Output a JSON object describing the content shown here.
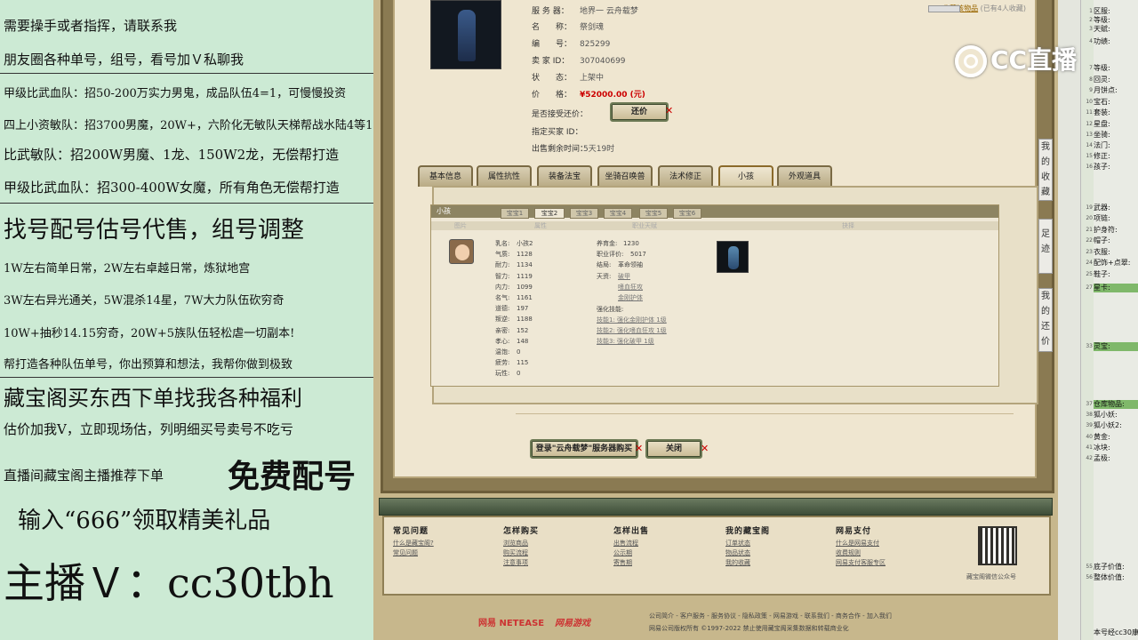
{
  "left_overlay": {
    "lines": [
      "需要操手或者指挥，请联系我",
      "朋友圈各种单号，组号，看号加Ｖ私聊我",
      "甲级比武血队：招50-200万实力男鬼，成品队伍4=1，可慢慢投资",
      "四上小资敏队：招3700男魔，20W+，六阶化无敏队天梯帮战水陆4等1",
      "比武敏队：招200W男魔、1龙、150W2龙，无偿帮打造",
      "甲级比武血队：招300-400W女魔，所有角色无偿帮打造",
      "找号配号估号代售，组号调整",
      "1W左右简单日常，2W左右卓越日常，炼狱地宫",
      "3W左右异光通关，5W混杀14星，7W大力队伍砍穷奇",
      "10W+抽秒14.15穷奇，20W+5族队伍轻松虐一切副本!",
      "帮打造各种队伍单号，你出预算和想法，我帮你做到极致",
      "藏宝阁买东西下单找我各种福利",
      "估价加我V，立即现场估，列明细买号卖号不吃亏",
      "直播间藏宝阁主播推荐下单",
      "免费配号",
      "输入“666”领取精美礼品",
      "主播Ｖ：cc30tbh"
    ]
  },
  "product": {
    "fields": [
      {
        "k": "服 务 器：",
        "v": "地界一 云舟载梦"
      },
      {
        "k": "名　　称：",
        "v": "祭剑魂"
      },
      {
        "k": "编　　号：",
        "v": "825299"
      },
      {
        "k": "卖 家 ID：",
        "v": "307040699"
      },
      {
        "k": "状　　态：",
        "v": "上架中"
      },
      {
        "k": "价　　格：",
        "v": "¥52000.00 (元)"
      },
      {
        "k": "是否接受还价：",
        "v": ""
      },
      {
        "k": "指定买家 ID：",
        "v": ""
      },
      {
        "k": "出售剩余时间：",
        "v": "5天19时"
      }
    ],
    "favorite": "收藏该物品",
    "favorite_count": "(已有4人收藏)",
    "counter_offer_button": "还价"
  },
  "tabs": [
    "基本信息",
    "属性抗性",
    "装备法宝",
    "坐骑召唤兽",
    "法术修正",
    "小孩",
    "外观道具"
  ],
  "active_tab": "小孩",
  "child_panel": {
    "title": "小孩",
    "subtabs": [
      "宝宝1",
      "宝宝2",
      "宝宝3",
      "宝宝4",
      "宝宝5",
      "宝宝6"
    ],
    "columns": [
      "图片",
      "属性",
      "职业天赋",
      "抉择"
    ],
    "stats_left": [
      {
        "k": "乳名:",
        "v": "小孩2"
      },
      {
        "k": "气质:",
        "v": "1128"
      },
      {
        "k": "耐力:",
        "v": "1134"
      },
      {
        "k": "智力:",
        "v": "1119"
      },
      {
        "k": "内力:",
        "v": "1099"
      },
      {
        "k": "名气:",
        "v": "1161"
      },
      {
        "k": "道德:",
        "v": "197"
      },
      {
        "k": "叛逆:",
        "v": "1188"
      },
      {
        "k": "亲密:",
        "v": "152"
      },
      {
        "k": "孝心:",
        "v": "148"
      },
      {
        "k": "温饱:",
        "v": "0"
      },
      {
        "k": "疲劳:",
        "v": "115"
      },
      {
        "k": "玩性:",
        "v": "0"
      }
    ],
    "stats_right": [
      {
        "k": "养育金:",
        "v": "1230"
      },
      {
        "k": "职业评价:",
        "v": "5017"
      },
      {
        "k": "结局:",
        "v": "革命领袖"
      },
      {
        "k": "天资:",
        "v": "破甲"
      }
    ],
    "talents_extra": [
      "嗜血狂攻",
      "金刚护体"
    ],
    "skills_title": "强化技能:",
    "skills": [
      "技能1: 强化金刚护体 1级",
      "技能2: 强化嗜血狂攻 1级",
      "技能3: 强化破甲 1级"
    ]
  },
  "buttons": {
    "login": "登录\"云舟载梦\"服务器购买",
    "close": "关闭"
  },
  "footer": {
    "columns": [
      {
        "title": "常见问题",
        "links": [
          "什么是藏宝阁?",
          "常见问题"
        ]
      },
      {
        "title": "怎样购买",
        "links": [
          "浏览商品",
          "购买流程",
          "注意事项"
        ]
      },
      {
        "title": "怎样出售",
        "links": [
          "出售流程",
          "公示期",
          "寄售期"
        ]
      },
      {
        "title": "我的藏宝阁",
        "links": [
          "订单状态",
          "物品状态",
          "我的收藏"
        ]
      },
      {
        "title": "网易支付",
        "links": [
          "什么是网易支付",
          "收费规则",
          "网易支付客服专区"
        ]
      }
    ],
    "qr_caption": "藏宝阁微信公众号",
    "bottom_links": "公司简介 - 客户服务 - 服务协议 - 隐私政策 - 网易游戏 - 联系我们 - 商务合作 - 加入我们",
    "copyright": "网易公司版权所有 ©1997-2022   禁止使用藏宝阁采集数据和转载商业化",
    "brand1": "网易 NETEASE",
    "brand2": "网易游戏"
  },
  "side_tabs": [
    "我的收藏",
    "足迹",
    "我的还价"
  ],
  "right_panel": {
    "rows": [
      {
        "n": "1",
        "t": "区服:",
        "g": false
      },
      {
        "n": "2",
        "t": "等级:",
        "g": false
      },
      {
        "n": "3",
        "t": "天赋:",
        "g": false
      },
      {
        "n": "4",
        "t": "功绩:",
        "g": false
      },
      {
        "n": "7",
        "t": "等级:",
        "g": false
      },
      {
        "n": "8",
        "t": "回灵:",
        "g": false
      },
      {
        "n": "9",
        "t": "月饼点:",
        "g": false
      },
      {
        "n": "10",
        "t": "宝石:",
        "g": false
      },
      {
        "n": "11",
        "t": "套装:",
        "g": false
      },
      {
        "n": "12",
        "t": "星盘:",
        "g": false
      },
      {
        "n": "13",
        "t": "坐骑:",
        "g": false
      },
      {
        "n": "14",
        "t": "法门:",
        "g": false
      },
      {
        "n": "15",
        "t": "修正:",
        "g": false
      },
      {
        "n": "16",
        "t": "孩子:",
        "g": false
      },
      {
        "n": "19",
        "t": "武器:",
        "g": false
      },
      {
        "n": "20",
        "t": "项链:",
        "g": false
      },
      {
        "n": "21",
        "t": "护身符:",
        "g": false
      },
      {
        "n": "22",
        "t": "帽子:",
        "g": false
      },
      {
        "n": "23",
        "t": "衣服:",
        "g": false
      },
      {
        "n": "24",
        "t": "配饰+点翠:",
        "g": false
      },
      {
        "n": "25",
        "t": "鞋子:",
        "g": false
      },
      {
        "n": "27",
        "t": "星卡:",
        "g": true
      },
      {
        "n": "33",
        "t": "灵宝:",
        "g": true
      },
      {
        "n": "37",
        "t": "仓库物品:",
        "g": true
      },
      {
        "n": "38",
        "t": "狐小妖:",
        "g": false
      },
      {
        "n": "39",
        "t": "狐小妖2:",
        "g": false
      },
      {
        "n": "40",
        "t": "黄金:",
        "g": false
      },
      {
        "n": "41",
        "t": "冰块:",
        "g": false
      },
      {
        "n": "42",
        "t": "孟极:",
        "g": false
      },
      {
        "n": "55",
        "t": "底子价值:",
        "g": false
      },
      {
        "n": "56",
        "t": "整体价值:",
        "g": false
      },
      {
        "n": "",
        "t": "本号经cc30康",
        "g": false
      }
    ]
  },
  "logo_text": "CC直播"
}
